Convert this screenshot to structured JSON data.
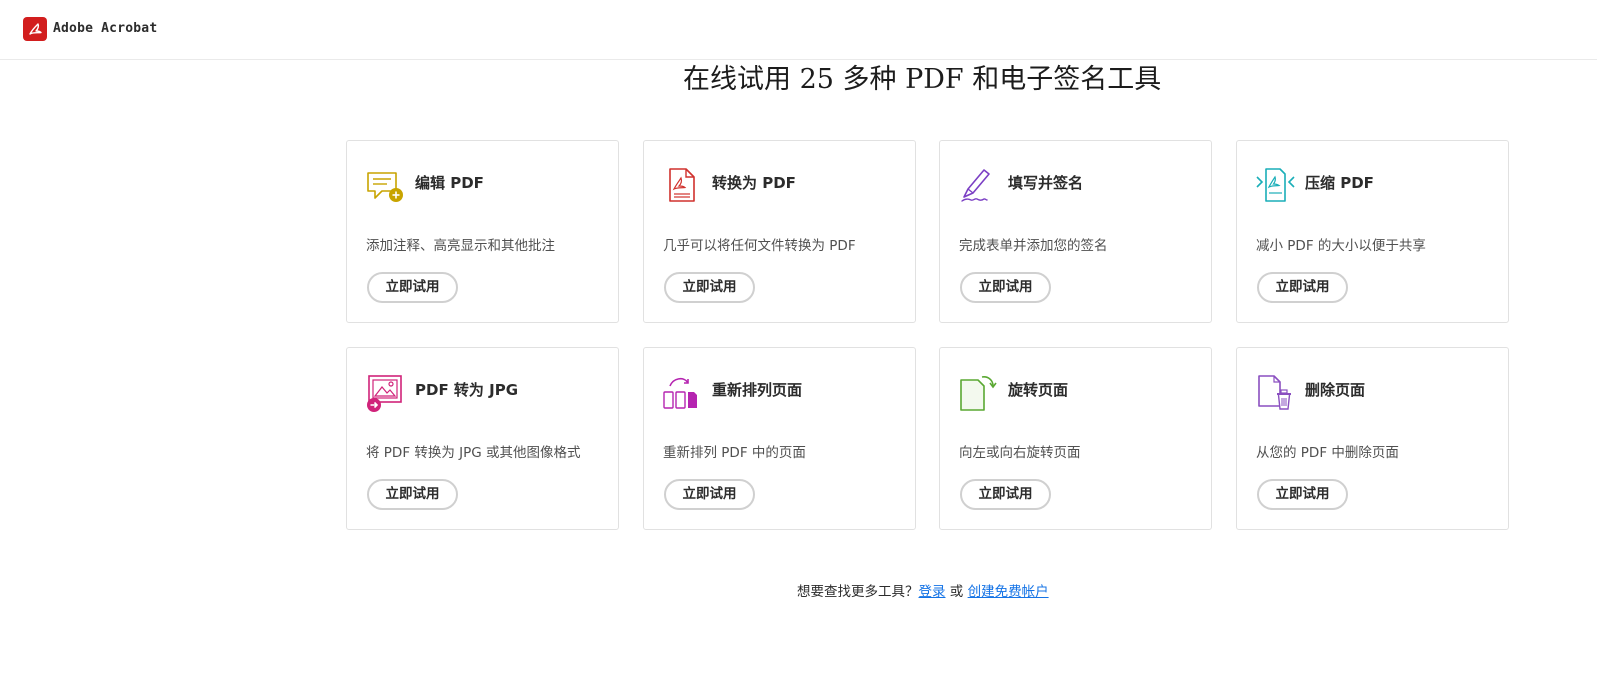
{
  "header": {
    "brand_name": "Adobe Acrobat"
  },
  "main": {
    "title": "在线试用 25 多种 PDF 和电子签名工具"
  },
  "tools": [
    {
      "title": "编辑 PDF",
      "description": "添加注释、高亮显示和其他批注",
      "button_label": "立即试用",
      "icon": "edit-pdf-icon",
      "accent": "#c8a400"
    },
    {
      "title": "转换为 PDF",
      "description": "几乎可以将任何文件转换为 PDF",
      "button_label": "立即试用",
      "icon": "convert-to-pdf-icon",
      "accent": "#d0312d"
    },
    {
      "title": "填写并签名",
      "description": "完成表单并添加您的签名",
      "button_label": "立即试用",
      "icon": "fill-sign-icon",
      "accent": "#7b3fc4"
    },
    {
      "title": "压缩 PDF",
      "description": "减小 PDF 的大小以便于共享",
      "button_label": "立即试用",
      "icon": "compress-pdf-icon",
      "accent": "#1aaeb8"
    },
    {
      "title": "PDF 转为 JPG",
      "description": "将 PDF 转换为 JPG 或其他图像格式",
      "button_label": "立即试用",
      "icon": "pdf-to-jpg-icon",
      "accent": "#d0237a"
    },
    {
      "title": "重新排列页面",
      "description": "重新排列 PDF 中的页面",
      "button_label": "立即试用",
      "icon": "reorder-pages-icon",
      "accent": "#b524b0"
    },
    {
      "title": "旋转页面",
      "description": "向左或向右旋转页面",
      "button_label": "立即试用",
      "icon": "rotate-pages-icon",
      "accent": "#5aa832"
    },
    {
      "title": "删除页面",
      "description": "从您的 PDF 中删除页面",
      "button_label": "立即试用",
      "icon": "delete-pages-icon",
      "accent": "#8a4fc0"
    }
  ],
  "footer": {
    "prompt": "想要查找更多工具？",
    "login_link": "登录",
    "or_text": "或",
    "signup_link": "创建免费帐户",
    "link_color": "#1473e6"
  }
}
